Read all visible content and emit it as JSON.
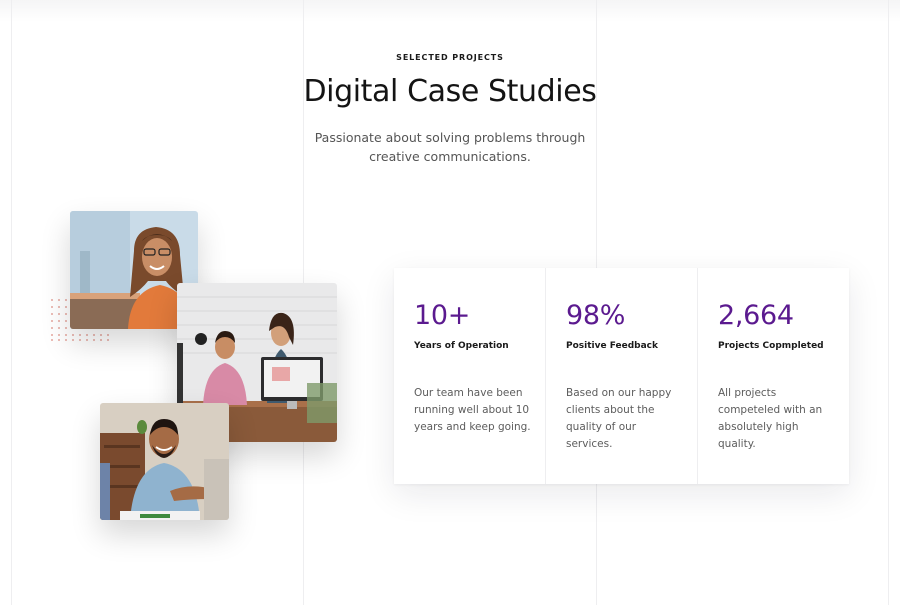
{
  "header": {
    "eyebrow": "SELECTED PROJECTS",
    "title": "Digital Case Studies",
    "subtitle": "Passionate about solving problems through creative communications."
  },
  "stats": [
    {
      "value": "10+",
      "label": "Years of Operation",
      "description": "Our team have been running well about 10 years and keep going."
    },
    {
      "value": "98%",
      "label": "Positive Feedback",
      "description": "Based on our happy clients about the quality of our services."
    },
    {
      "value": "2,664",
      "label": "Projects Copmpleted",
      "description": "All projects competeled with an absolutely high quality."
    }
  ],
  "colors": {
    "accent": "#5b1a8f",
    "dot_pattern": "#e6a8a0"
  }
}
